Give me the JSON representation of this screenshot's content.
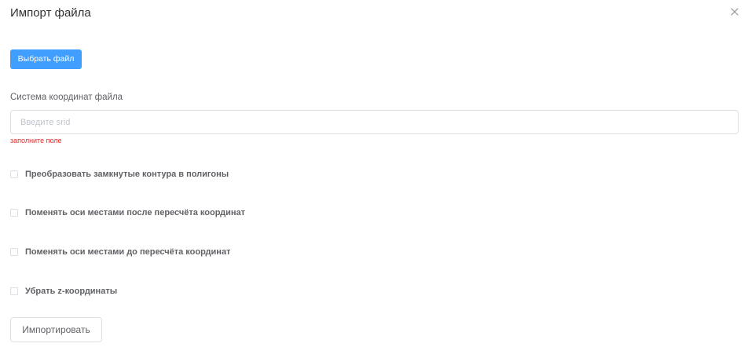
{
  "dialog": {
    "title": "Импорт файла",
    "choose_file_label": "Выбрать файл",
    "coordinate_system": {
      "label": "Система координат файла",
      "value": "",
      "placeholder": "Введите srid",
      "error": "заполните поле"
    },
    "options": [
      {
        "label": "Преобразовать замкнутые контура в полигоны",
        "checked": false
      },
      {
        "label": "Поменять оси местами после пересчёта координат",
        "checked": false
      },
      {
        "label": "Поменять оси местами до пересчёта координат",
        "checked": false
      },
      {
        "label": "Убрать z-координаты",
        "checked": false
      }
    ],
    "import_label": "Импортировать"
  },
  "icons": {
    "close": "close-icon"
  },
  "colors": {
    "primary": "#409EFF",
    "error": "#E02A2A",
    "title_text": "#303133",
    "regular_text": "#606266",
    "border": "#DCDFE6",
    "placeholder": "#C0C4CC",
    "close_icon": "#909399"
  }
}
